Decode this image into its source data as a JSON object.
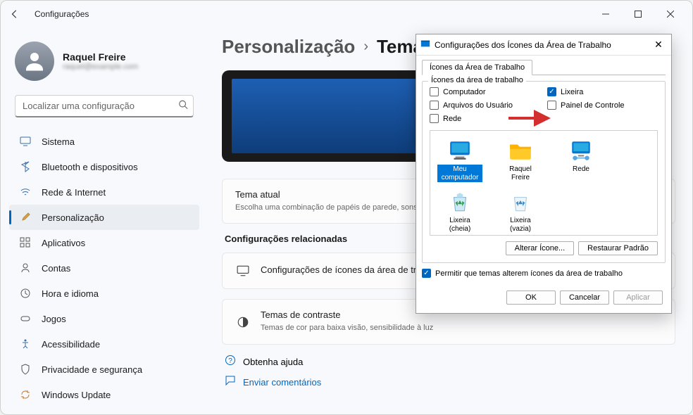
{
  "window": {
    "title": "Configurações"
  },
  "profile": {
    "name": "Raquel Freire",
    "email": "raquel@example.com"
  },
  "search": {
    "placeholder": "Localizar uma configuração"
  },
  "sidebar": {
    "items": [
      {
        "label": "Sistema"
      },
      {
        "label": "Bluetooth e dispositivos"
      },
      {
        "label": "Rede & Internet"
      },
      {
        "label": "Personalização"
      },
      {
        "label": "Aplicativos"
      },
      {
        "label": "Contas"
      },
      {
        "label": "Hora e idioma"
      },
      {
        "label": "Jogos"
      },
      {
        "label": "Acessibilidade"
      },
      {
        "label": "Privacidade e segurança"
      },
      {
        "label": "Windows Update"
      }
    ]
  },
  "breadcrumb": {
    "parent": "Personalização",
    "current": "Temas"
  },
  "theme_card": {
    "title": "Tema atual",
    "sub": "Escolha uma combinação de papéis de parede, sons e cores para dar personalidade à sua área de trabalho"
  },
  "related_section": "Configurações relacionadas",
  "related_card": {
    "title": "Configurações de ícones da área de trabalho"
  },
  "contrast_card": {
    "title": "Temas de contraste",
    "sub": "Temas de cor para baixa visão, sensibilidade à luz"
  },
  "help_section": "Obtenha ajuda",
  "help_item": "Enviar comentários",
  "dialog": {
    "title": "Configurações dos Ícones da Área de Trabalho",
    "tab": "Ícones da Área de Trabalho",
    "group_label": "Ícones da área de trabalho",
    "checks": {
      "computador": "Computador",
      "lixeira": "Lixeira",
      "arquivos": "Arquivos do Usuário",
      "painel": "Painel de Controle",
      "rede": "Rede"
    },
    "icons": {
      "computador": "Meu computador",
      "raquel": "Raquel Freire",
      "rede": "Rede",
      "lixeira_cheia": "Lixeira (cheia)",
      "lixeira_vazia": "Lixeira (vazia)"
    },
    "btn_change": "Alterar Ícone...",
    "btn_restore": "Restaurar Padrão",
    "perm": "Permitir que temas alterem ícones da área de trabalho",
    "ok": "OK",
    "cancel": "Cancelar",
    "apply": "Aplicar"
  }
}
